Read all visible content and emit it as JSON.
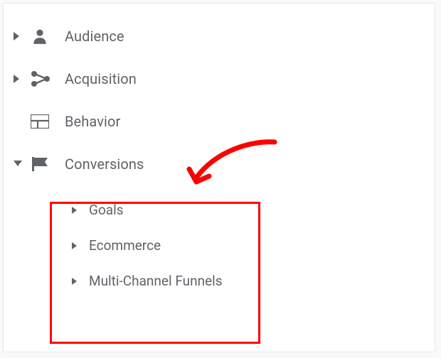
{
  "nav": {
    "items": [
      {
        "label": "Audience",
        "expanded": false
      },
      {
        "label": "Acquisition",
        "expanded": false
      },
      {
        "label": "Behavior",
        "expanded": false
      },
      {
        "label": "Conversions",
        "expanded": true
      }
    ]
  },
  "conversions": {
    "subitems": [
      {
        "label": "Goals"
      },
      {
        "label": "Ecommerce"
      },
      {
        "label": "Multi-Channel Funnels"
      }
    ]
  }
}
